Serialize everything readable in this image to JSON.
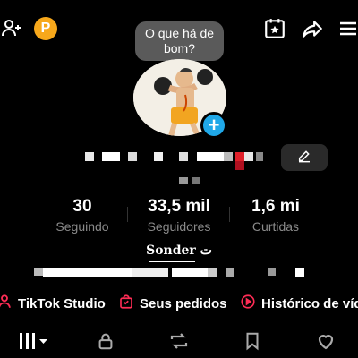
{
  "profile": {
    "bubble_text": "O que há de bom?",
    "coin_letter": "P"
  },
  "stats": [
    {
      "value": "30",
      "label": "Seguindo"
    },
    {
      "value": "33,5 mil",
      "label": "Seguidores"
    },
    {
      "value": "1,6 mi",
      "label": "Curtidas"
    }
  ],
  "bio": {
    "title": "Sonder ت"
  },
  "links": {
    "studio": "TikTok Studio",
    "orders": "Seus pedidos",
    "history": "Histórico de víd"
  },
  "colors": {
    "accent": "#fe2c55",
    "coin": "#f7a81b",
    "add_button": "#20a8e8"
  }
}
